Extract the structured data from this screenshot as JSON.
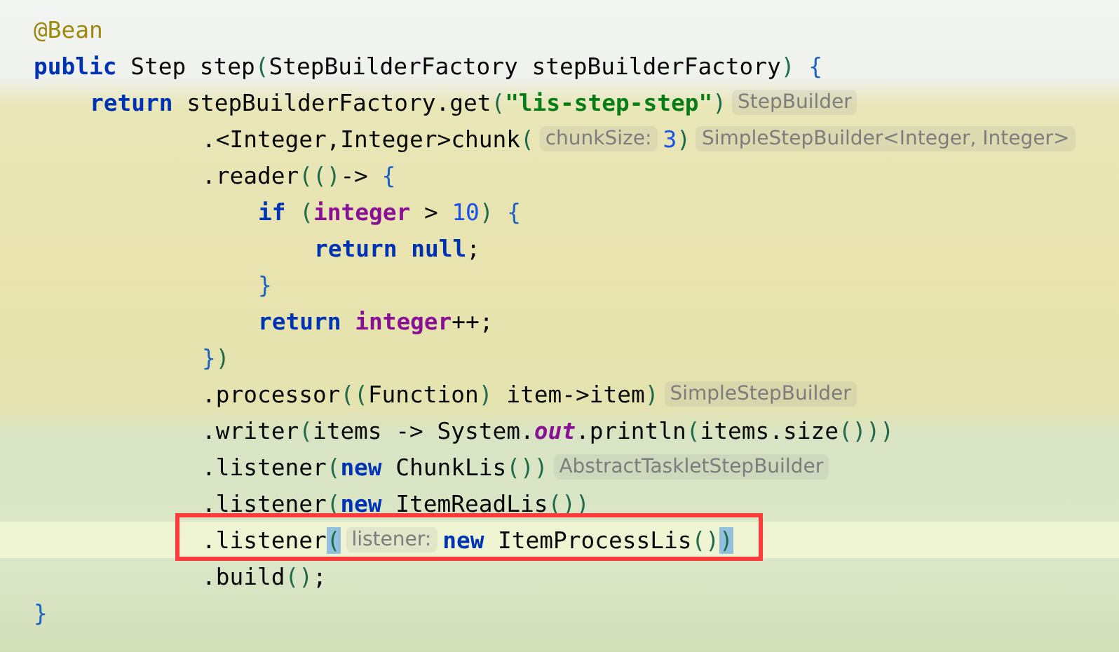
{
  "editor": {
    "lines": [
      {
        "current": false,
        "segments": [
          {
            "kind": "code",
            "tokens": [
              {
                "t": "@Bean",
                "kind": "annotation"
              }
            ]
          }
        ]
      },
      {
        "current": false,
        "segments": [
          {
            "kind": "code",
            "tokens": [
              {
                "t": "public",
                "kind": "kw"
              },
              {
                "t": " Step step",
                "kind": "plain"
              },
              {
                "t": "(",
                "kind": "paren"
              },
              {
                "t": "StepBuilderFactory stepBuilderFactory",
                "kind": "plain"
              },
              {
                "t": ")",
                "kind": "paren"
              },
              {
                "t": " {",
                "kind": "brace"
              }
            ]
          }
        ],
        "children": [
          {
            "current": false,
            "segments": [
              {
                "kind": "code",
                "tokens": [
                  {
                    "t": "return",
                    "kind": "kw"
                  },
                  {
                    "t": " stepBuilderFactory.get",
                    "kind": "plain"
                  },
                  {
                    "t": "(",
                    "kind": "paren"
                  },
                  {
                    "t": "\"lis-step-step\"",
                    "kind": "str"
                  },
                  {
                    "t": ")",
                    "kind": "paren"
                  }
                ]
              },
              {
                "kind": "hint",
                "text": "StepBuilder"
              }
            ],
            "continuation": [
              {
                "current": false,
                "segments": [
                  {
                    "kind": "code",
                    "tokens": [
                      {
                        "t": ".<Integer,Integer>chunk",
                        "kind": "plain"
                      },
                      {
                        "t": "(",
                        "kind": "paren"
                      }
                    ]
                  },
                  {
                    "kind": "hint",
                    "text": "chunkSize:"
                  },
                  {
                    "kind": "code",
                    "tokens": [
                      {
                        "t": "3",
                        "kind": "num"
                      },
                      {
                        "t": ")",
                        "kind": "paren"
                      }
                    ]
                  },
                  {
                    "kind": "hint",
                    "text": "SimpleStepBuilder<Integer, Integer>"
                  }
                ]
              },
              {
                "current": false,
                "segments": [
                  {
                    "kind": "code",
                    "tokens": [
                      {
                        "t": ".reader",
                        "kind": "plain"
                      },
                      {
                        "t": "(()",
                        "kind": "paren"
                      },
                      {
                        "t": "->",
                        "kind": "plain"
                      },
                      {
                        "t": " {",
                        "kind": "brace"
                      }
                    ]
                  }
                ],
                "children": [
                  {
                    "current": false,
                    "segments": [
                      {
                        "kind": "code",
                        "tokens": [
                          {
                            "t": "if",
                            "kind": "kw"
                          },
                          {
                            "t": " (",
                            "kind": "paren"
                          },
                          {
                            "t": "integer",
                            "kind": "var"
                          },
                          {
                            "t": " > ",
                            "kind": "plain"
                          },
                          {
                            "t": "10",
                            "kind": "num"
                          },
                          {
                            "t": ")",
                            "kind": "paren"
                          },
                          {
                            "t": " {",
                            "kind": "brace"
                          }
                        ]
                      }
                    ],
                    "children": [
                      {
                        "current": false,
                        "segments": [
                          {
                            "kind": "code",
                            "tokens": [
                              {
                                "t": "return",
                                "kind": "kw"
                              },
                              {
                                "t": " null",
                                "kind": "kw"
                              },
                              {
                                "t": ";",
                                "kind": "plain"
                              }
                            ]
                          }
                        ]
                      }
                    ]
                  },
                  {
                    "current": false,
                    "segments": [
                      {
                        "kind": "code",
                        "tokens": [
                          {
                            "t": "}",
                            "kind": "brace"
                          }
                        ]
                      }
                    ]
                  },
                  {
                    "current": false,
                    "segments": [
                      {
                        "kind": "code",
                        "tokens": [
                          {
                            "t": "return",
                            "kind": "kw"
                          },
                          {
                            "t": " integer",
                            "kind": "var"
                          },
                          {
                            "t": "++;",
                            "kind": "plain"
                          }
                        ]
                      }
                    ]
                  }
                ]
              },
              {
                "current": false,
                "segments": [
                  {
                    "kind": "code",
                    "tokens": [
                      {
                        "t": "}",
                        "kind": "brace"
                      },
                      {
                        "t": ")",
                        "kind": "paren"
                      }
                    ]
                  }
                ]
              },
              {
                "current": false,
                "segments": [
                  {
                    "kind": "code",
                    "tokens": [
                      {
                        "t": ".processor",
                        "kind": "plain"
                      },
                      {
                        "t": "((",
                        "kind": "paren"
                      },
                      {
                        "t": "Function",
                        "kind": "plain"
                      },
                      {
                        "t": ")",
                        "kind": "paren"
                      },
                      {
                        "t": " item->item",
                        "kind": "plain"
                      },
                      {
                        "t": ")",
                        "kind": "paren"
                      }
                    ]
                  },
                  {
                    "kind": "hint",
                    "text": "SimpleStepBuilder"
                  }
                ]
              },
              {
                "current": false,
                "segments": [
                  {
                    "kind": "code",
                    "tokens": [
                      {
                        "t": ".writer",
                        "kind": "plain"
                      },
                      {
                        "t": "(",
                        "kind": "paren"
                      },
                      {
                        "t": "items -> System.",
                        "kind": "plain"
                      },
                      {
                        "t": "out",
                        "kind": "field"
                      },
                      {
                        "t": ".println",
                        "kind": "plain"
                      },
                      {
                        "t": "(",
                        "kind": "paren"
                      },
                      {
                        "t": "items.size",
                        "kind": "plain"
                      },
                      {
                        "t": "()))",
                        "kind": "paren"
                      }
                    ]
                  }
                ]
              },
              {
                "current": false,
                "segments": [
                  {
                    "kind": "code",
                    "tokens": [
                      {
                        "t": ".listener",
                        "kind": "plain"
                      },
                      {
                        "t": "(",
                        "kind": "paren"
                      },
                      {
                        "t": "new",
                        "kind": "kw"
                      },
                      {
                        "t": " ChunkLis",
                        "kind": "plain"
                      },
                      {
                        "t": "())",
                        "kind": "paren"
                      }
                    ]
                  },
                  {
                    "kind": "hint",
                    "text": "AbstractTaskletStepBuilder"
                  }
                ]
              },
              {
                "current": false,
                "segments": [
                  {
                    "kind": "code",
                    "tokens": [
                      {
                        "t": ".listener",
                        "kind": "plain"
                      },
                      {
                        "t": "(",
                        "kind": "paren"
                      },
                      {
                        "t": "new",
                        "kind": "kw"
                      },
                      {
                        "t": " ItemReadLis",
                        "kind": "plain"
                      },
                      {
                        "t": "())",
                        "kind": "paren"
                      }
                    ]
                  }
                ]
              },
              {
                "current": true,
                "segments": [
                  {
                    "kind": "code",
                    "tokens": [
                      {
                        "t": ".listener",
                        "kind": "plain"
                      },
                      {
                        "t": "(",
                        "kind": "match"
                      }
                    ]
                  },
                  {
                    "kind": "hint",
                    "text": "listener:"
                  },
                  {
                    "kind": "code",
                    "tokens": [
                      {
                        "t": "new",
                        "kind": "kw"
                      },
                      {
                        "t": " ItemProcessLis",
                        "kind": "plain"
                      },
                      {
                        "t": "()",
                        "kind": "paren"
                      },
                      {
                        "t": ")",
                        "kind": "match"
                      }
                    ]
                  }
                ]
              },
              {
                "current": false,
                "segments": [
                  {
                    "kind": "code",
                    "tokens": [
                      {
                        "t": ".build",
                        "kind": "plain"
                      },
                      {
                        "t": "()",
                        "kind": "paren"
                      },
                      {
                        "t": ";",
                        "kind": "plain"
                      }
                    ]
                  }
                ]
              }
            ]
          }
        ]
      },
      {
        "current": false,
        "segments": [
          {
            "kind": "code",
            "tokens": [
              {
                "t": "}",
                "kind": "brace"
              }
            ]
          }
        ]
      }
    ]
  }
}
